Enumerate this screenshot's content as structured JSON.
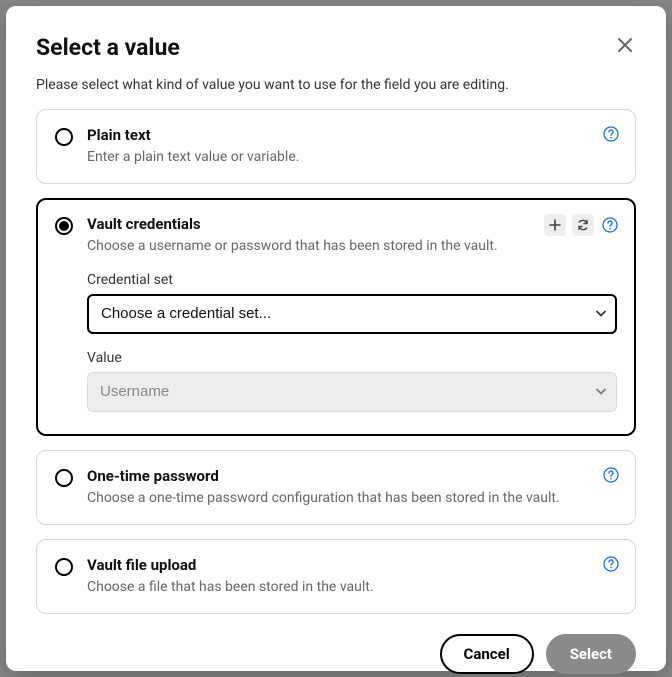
{
  "header": {
    "title": "Select a value",
    "subtitle": "Please select what kind of value you want to use for the field you are editing."
  },
  "options": {
    "plain_text": {
      "title": "Plain text",
      "desc": "Enter a plain text value or variable."
    },
    "vault_credentials": {
      "title": "Vault credentials",
      "desc": "Choose a username or password that has been stored in the vault.",
      "credential_set_label": "Credential set",
      "credential_set_placeholder": "Choose a credential set...",
      "value_label": "Value",
      "value_selected": "Username"
    },
    "one_time_password": {
      "title": "One-time password",
      "desc": "Choose a one-time password configuration that has been stored in the vault."
    },
    "vault_file_upload": {
      "title": "Vault file upload",
      "desc": "Choose a file that has been stored in the vault."
    }
  },
  "footer": {
    "cancel": "Cancel",
    "select": "Select"
  }
}
